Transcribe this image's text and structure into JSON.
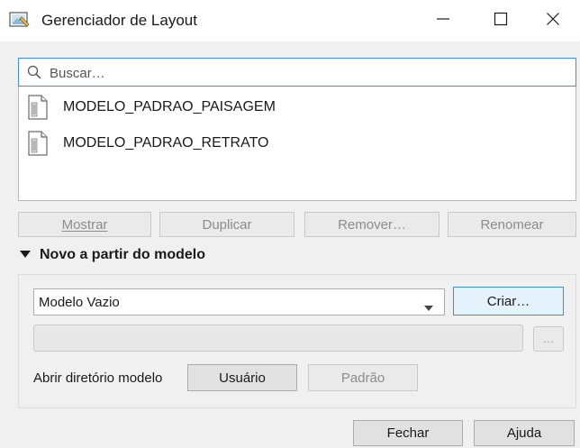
{
  "window": {
    "title": "Gerenciador de Layout",
    "app_icon": "layout-manager-icon",
    "controls": [
      "minimize-icon",
      "maximize-icon",
      "close-icon"
    ]
  },
  "search": {
    "placeholder": "Buscar…",
    "value": ""
  },
  "layouts": [
    {
      "label": "MODELO_PADRAO_PAISAGEM",
      "icon": "layout-document-icon"
    },
    {
      "label": "MODELO_PADRAO_RETRATO",
      "icon": "layout-document-icon"
    }
  ],
  "list_actions": {
    "show": "Mostrar",
    "duplicate": "Duplicar",
    "remove": "Remover…",
    "rename": "Renomear"
  },
  "new_from_template": {
    "title": "Novo a partir do modelo",
    "template_selected": "Modelo Vazio",
    "create_label": "Criar…",
    "path_value": "",
    "browse_label": "…",
    "open_dir_label": "Abrir diretório modelo",
    "user_label": "Usuário",
    "default_label": "Padrão"
  },
  "footer": {
    "close_label": "Fechar",
    "help_label": "Ajuda"
  },
  "colors": {
    "focus_border": "#3d8ee0",
    "window_bg": "#f0f0f0",
    "button_bg": "#e1e1e1",
    "disabled_text": "#8c8c8c"
  }
}
